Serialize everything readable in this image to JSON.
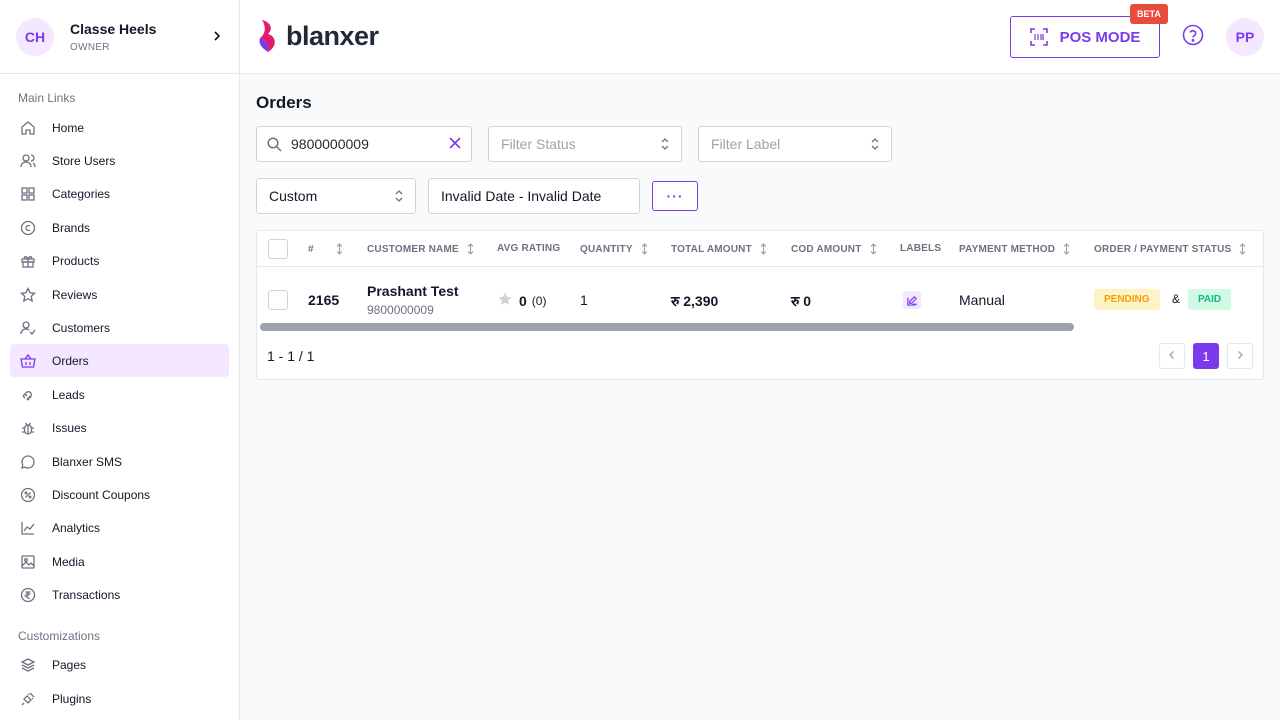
{
  "store": {
    "initials": "CH",
    "name": "Classe Heels",
    "role": "OWNER"
  },
  "sidebar": {
    "main_section": "Main Links",
    "items": [
      {
        "label": "Home",
        "icon": "home-icon"
      },
      {
        "label": "Store Users",
        "icon": "users-icon"
      },
      {
        "label": "Categories",
        "icon": "grid-icon"
      },
      {
        "label": "Brands",
        "icon": "copyright-icon"
      },
      {
        "label": "Products",
        "icon": "gift-icon"
      },
      {
        "label": "Reviews",
        "icon": "star-icon"
      },
      {
        "label": "Customers",
        "icon": "user-check-icon"
      },
      {
        "label": "Orders",
        "icon": "basket-icon",
        "active": true
      },
      {
        "label": "Leads",
        "icon": "magnet-icon"
      },
      {
        "label": "Issues",
        "icon": "bug-icon"
      },
      {
        "label": "Blanxer SMS",
        "icon": "message-icon"
      },
      {
        "label": "Discount Coupons",
        "icon": "discount-icon"
      },
      {
        "label": "Analytics",
        "icon": "chart-line-icon"
      },
      {
        "label": "Media",
        "icon": "image-icon"
      },
      {
        "label": "Transactions",
        "icon": "rupee-icon"
      }
    ],
    "custom_section": "Customizations",
    "custom_items": [
      {
        "label": "Pages",
        "icon": "layers-icon"
      },
      {
        "label": "Plugins",
        "icon": "plug-icon"
      }
    ]
  },
  "header": {
    "logo_text": "blanxer",
    "pos_label": "POS MODE",
    "beta_label": "BETA",
    "user_initials": "PP"
  },
  "page": {
    "title": "Orders"
  },
  "filters": {
    "search_value": "9800000009",
    "status_placeholder": "Filter Status",
    "label_placeholder": "Filter Label",
    "date_preset": "Custom",
    "date_range": "Invalid Date - Invalid Date",
    "more_label": "···"
  },
  "table": {
    "columns": [
      "#",
      "CUSTOMER NAME",
      "AVG RATING",
      "QUANTITY",
      "TOTAL AMOUNT",
      "COD AMOUNT",
      "LABELS",
      "PAYMENT METHOD",
      "ORDER / PAYMENT STATUS"
    ],
    "rows": [
      {
        "id": "2165",
        "customer_name": "Prashant Test",
        "customer_phone": "9800000009",
        "rating": "0",
        "rating_count": "(0)",
        "quantity": "1",
        "total": "रु 2,390",
        "cod": "रु 0",
        "payment_method": "Manual",
        "order_status": "PENDING",
        "status_joiner": "&",
        "payment_status": "PAID"
      }
    ],
    "pagination_text": "1 - 1 / 1",
    "current_page": "1"
  },
  "colors": {
    "accent": "#7c3aed",
    "accent_light": "#f3e8ff",
    "pending": "#f59e0b",
    "paid": "#10b981",
    "beta": "#e74c3c"
  }
}
